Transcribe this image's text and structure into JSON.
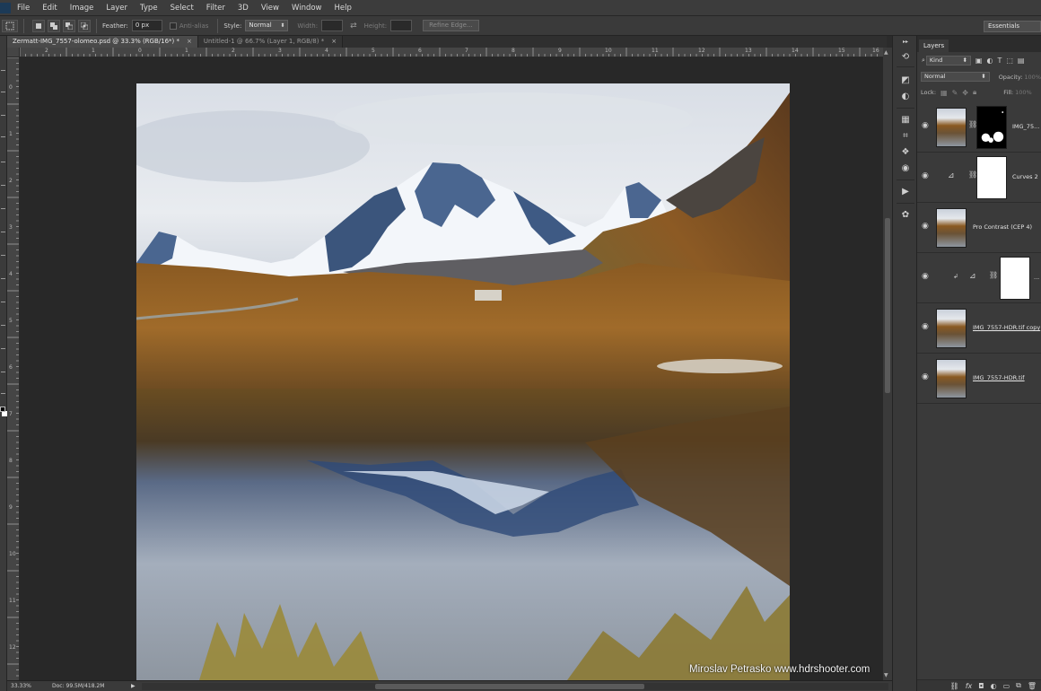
{
  "menu": [
    "File",
    "Edit",
    "Image",
    "Layer",
    "Type",
    "Select",
    "Filter",
    "3D",
    "View",
    "Window",
    "Help"
  ],
  "options": {
    "feather_label": "Feather:",
    "feather_value": "0 px",
    "anti_alias_label": "Anti-alias",
    "style_label": "Style:",
    "style_value": "Normal",
    "width_label": "Width:",
    "height_label": "Height:",
    "refine_edge_label": "Refine Edge...",
    "workspace": "Essentials"
  },
  "tabs": [
    {
      "label": "Zermatt-IMG_7557-olomeo.psd @ 33.3% (RGB/16*) *",
      "close": "×"
    },
    {
      "label": "Untitled-1 @ 66.7% (Layer 1, RGB/8) *",
      "close": "×"
    }
  ],
  "ruler": {
    "h": [
      "2",
      "1",
      "0",
      "1",
      "2",
      "3",
      "4",
      "5",
      "6",
      "7",
      "8",
      "9",
      "10",
      "11",
      "12",
      "13",
      "14",
      "15",
      "16"
    ],
    "v": [
      "0",
      "1",
      "2",
      "3",
      "4",
      "5",
      "6",
      "7",
      "8",
      "9",
      "10",
      "11",
      "12"
    ]
  },
  "canvas": {
    "watermark": "Miroslav  Petrasko  www.hdrshooter.com"
  },
  "status": {
    "zoom": "33.33%",
    "doc": "Doc: 99.5M/418.2M",
    "arrow": "▶"
  },
  "layers_panel": {
    "title": "Layers",
    "filter_value": "Kind",
    "blend_mode": "Normal",
    "opacity_label": "Opacity:",
    "opacity_value": "100%",
    "lock_label": "Lock:",
    "fill_label": "Fill:",
    "fill_value": "100%",
    "layers": [
      {
        "name": "IMG_75...",
        "kind": "image-with-mask"
      },
      {
        "name": "Curves 2",
        "kind": "adjustment"
      },
      {
        "name": "Pro Contrast (CEP 4)",
        "kind": "image"
      },
      {
        "name": "...",
        "kind": "clipped-adjustment"
      },
      {
        "name": "IMG_7557-HDR.tif copy",
        "kind": "image"
      },
      {
        "name": "IMG_7557-HDR.tif",
        "kind": "image"
      }
    ]
  }
}
